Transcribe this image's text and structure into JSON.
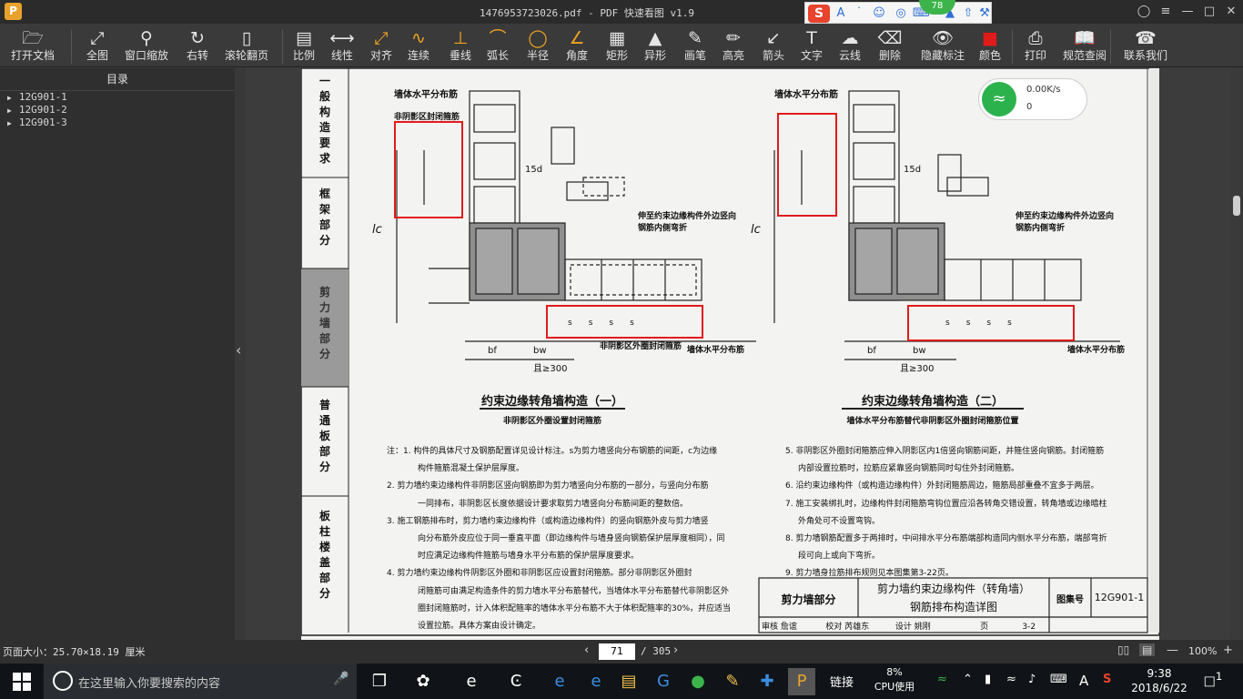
{
  "window": {
    "title": "1476953723026.pdf - PDF 快速看图 v1.9"
  },
  "ime": {
    "badge": "78"
  },
  "toolbar": {
    "items": [
      {
        "label": "打开文档",
        "icon": "folder-icon"
      },
      {
        "label": "全图",
        "icon": "fit-all-icon"
      },
      {
        "label": "窗口缩放",
        "icon": "zoom-window-icon"
      },
      {
        "label": "右转",
        "icon": "rotate-right-icon"
      },
      {
        "label": "滚轮翻页",
        "icon": "mouse-wheel-icon"
      },
      {
        "label": "比例",
        "icon": "scale-icon"
      },
      {
        "label": "线性",
        "icon": "linear-measure-icon"
      },
      {
        "label": "对齐",
        "icon": "align-measure-icon"
      },
      {
        "label": "连续",
        "icon": "continuous-measure-icon"
      },
      {
        "label": "垂线",
        "icon": "perpendicular-icon"
      },
      {
        "label": "弧长",
        "icon": "arc-length-icon"
      },
      {
        "label": "半径",
        "icon": "radius-icon"
      },
      {
        "label": "角度",
        "icon": "angle-icon"
      },
      {
        "label": "矩形",
        "icon": "rectangle-area-icon"
      },
      {
        "label": "异形",
        "icon": "polygon-area-icon"
      },
      {
        "label": "画笔",
        "icon": "pen-icon"
      },
      {
        "label": "高亮",
        "icon": "highlighter-icon"
      },
      {
        "label": "箭头",
        "icon": "arrow-icon"
      },
      {
        "label": "文字",
        "icon": "text-icon"
      },
      {
        "label": "云线",
        "icon": "cloud-line-icon"
      },
      {
        "label": "删除",
        "icon": "eraser-icon"
      },
      {
        "label": "隐藏标注",
        "icon": "hide-annotation-icon"
      },
      {
        "label": "颜色",
        "icon": "color-swatch-icon"
      },
      {
        "label": "打印",
        "icon": "printer-icon"
      },
      {
        "label": "规范查阅",
        "icon": "spec-book-icon"
      },
      {
        "label": "联系我们",
        "icon": "contact-icon"
      }
    ]
  },
  "sidebar": {
    "title": "目录",
    "items": [
      "12G901-1",
      "12G901-2",
      "12G901-3"
    ]
  },
  "wifi_widget": {
    "speed": "0.00K/s",
    "count": "0"
  },
  "drawing": {
    "side_tabs": [
      "一般构造要求",
      "框架部分",
      "剪力墙部分",
      "普通板部分",
      "板柱楼盖部分"
    ],
    "left_title": "约束边缘转角墙构造（一）",
    "left_subtitle": "非阴影区外圈设置封闭箍筋",
    "right_title": "约束边缘转角墙构造（二）",
    "right_subtitle": "墙体水平分布筋替代非阴影区外圈封闭箍筋位置",
    "label_wall_horizontal": "墙体水平分布筋",
    "label_nonshadow_hoop": "非阴影区封闭箍筋",
    "label_extend": "伸至约束边缘构件外边竖向钢筋内侧弯折",
    "label_nonshadow_outer": "非阴影区外圈封闭箍筋",
    "dim_15d": "15d",
    "dim_bf": "bf",
    "dim_bw": "bw",
    "dim_lc": "lc",
    "dim_300": "且≥300",
    "dim_s": "s",
    "dim_c": "c",
    "notes_left": [
      "注：1. 构件的具体尺寸及钢筋配置详见设计标注。s为剪力墙竖向分布钢筋的间距，c为边缘",
      "构件箍筋混凝土保护层厚度。",
      "2. 剪力墙约束边缘构件非阴影区竖向钢筋即为剪力墙竖向分布筋的一部分，与竖向分布筋",
      "一同排布，非阴影区长度依据设计要求取剪力墙竖向分布筋间距的整数倍。",
      "3. 施工钢筋排布时，剪力墙约束边缘构件（或构造边缘构件）的竖向钢筋外皮与剪力墙竖",
      "向分布筋外皮应位于同一垂直平面（即边缘构件与墙身竖向钢筋保护层厚度相同），同",
      "时应满足边缘构件箍筋与墙身水平分布筋的保护层厚度要求。",
      "4. 剪力墙约束边缘构件阴影区外圈和非阴影区应设置封闭箍筋。部分非阴影区外圈封",
      "闭箍筋可由满足构造条件的剪力墙水平分布筋替代，当墙体水平分布筋替代非阴影区外",
      "圈封闭箍筋时，计入体积配箍率的墙体水平分布筋不大于体积配箍率的30%，并应适当",
      "设置拉筋。具体方案由设计确定。"
    ],
    "notes_right": [
      "5. 非阴影区外圈封闭箍筋应伸入阴影区内1倍竖向钢筋间距，并箍住竖向钢筋。封闭箍筋",
      "内部设置拉筋时，拉筋应紧靠竖向钢筋同时勾住外封闭箍筋。",
      "6. 沿约束边缘构件（或构造边缘构件）外封闭箍筋周边，箍筋局部重叠不宜多于两层。",
      "7. 施工安装绑扎时，边缘构件封闭箍筋弯钩位置应沿各转角交错设置，转角墙或边缘暗柱",
      "外角处可不设置弯钩。",
      "8. 剪力墙钢筋配置多于两排时，中间排水平分布筋端部构造同内侧水平分布筋，端部弯折",
      "段可向上或向下弯折。",
      "9. 剪力墙身拉筋排布规则见本图集第3-22页。"
    ],
    "titleblock": {
      "section": "剪力墙部分",
      "name1": "剪力墙约束边缘构件（转角墙）",
      "name2": "钢筋排布构造详图",
      "atlas_label": "图集号",
      "atlas_no": "12G901-1",
      "review": "审核",
      "reviewer": "詹谊",
      "check": "校对",
      "checker": "芮雄东",
      "design": "设计",
      "designer": "姚刚",
      "page_label": "页",
      "page_no": "3-2"
    }
  },
  "statusbar": {
    "page_size": "页面大小：25.70×18.19 厘米",
    "current_page": "71",
    "total_pages": "/ 305",
    "zoom": "100%"
  },
  "taskbar": {
    "search_placeholder": "在这里输入你要搜索的内容",
    "link_label": "链接",
    "cpu_percent": "8%",
    "cpu_label": "CPU使用",
    "ime_lang": "A",
    "time": "9:38",
    "date": "2018/6/22",
    "notifications": "1"
  },
  "colors": {
    "highlight_box": "#e01b1b",
    "app_orange": "#e8a22c",
    "wifi_green": "#2bb24c"
  }
}
